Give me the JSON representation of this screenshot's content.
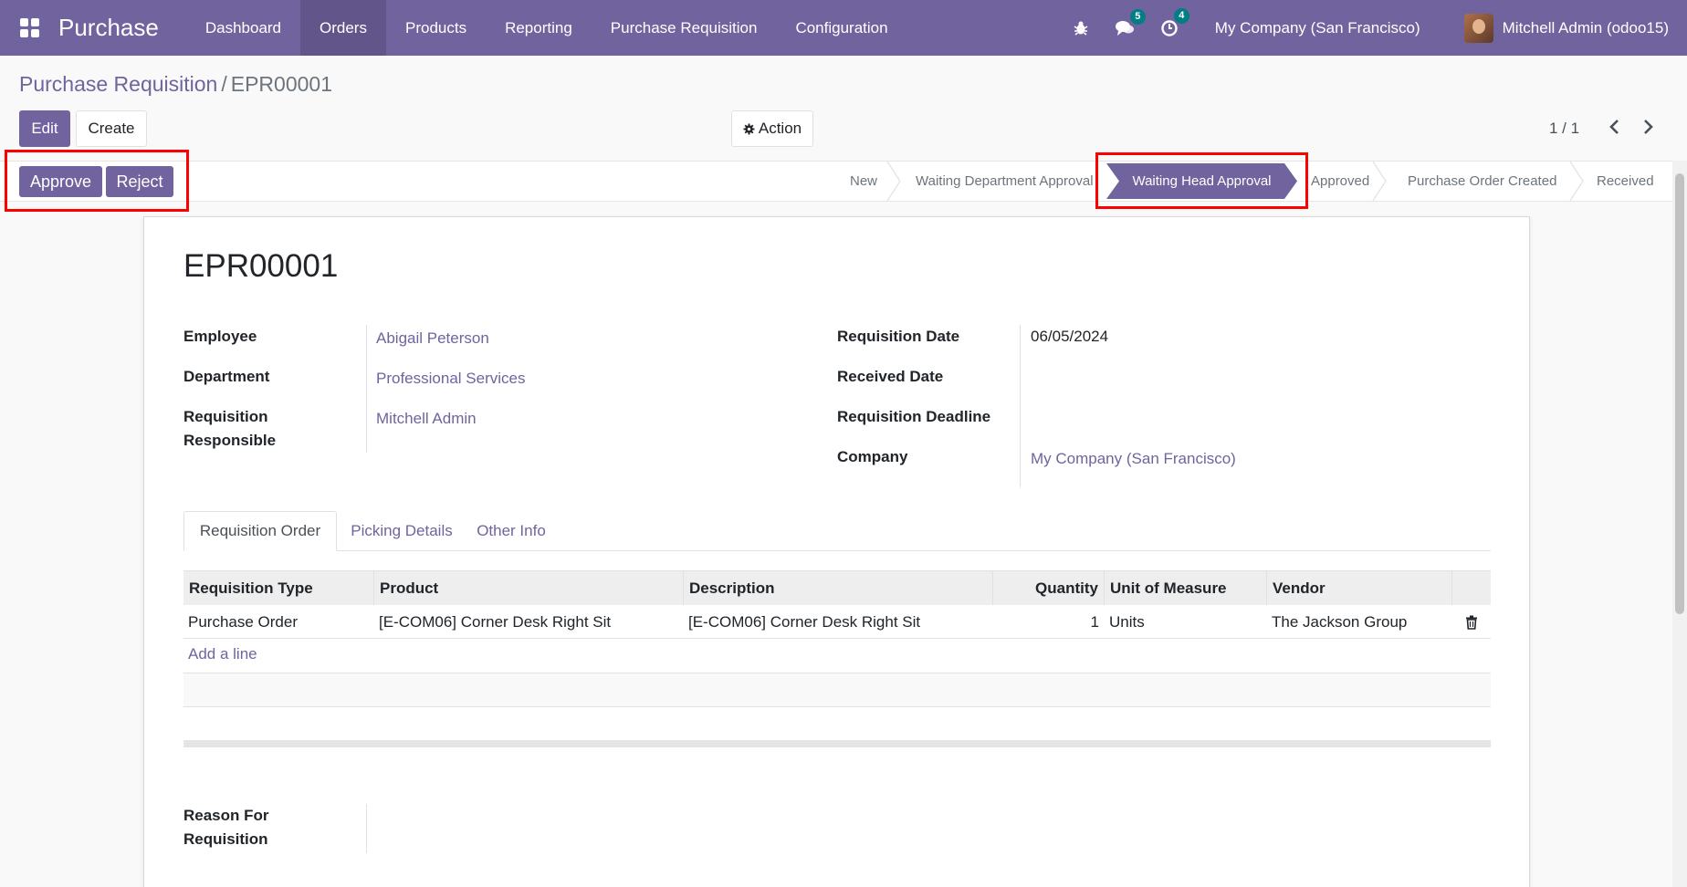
{
  "navbar": {
    "brand": "Purchase",
    "menu": [
      "Dashboard",
      "Orders",
      "Products",
      "Reporting",
      "Purchase Requisition",
      "Configuration"
    ],
    "active_menu": "Orders",
    "messages_count": "5",
    "activities_count": "4",
    "company": "My Company (San Francisco)",
    "user": "Mitchell Admin (odoo15)"
  },
  "breadcrumb": {
    "parent": "Purchase Requisition",
    "separator": "/",
    "current": "EPR00001"
  },
  "control": {
    "edit_label": "Edit",
    "create_label": "Create",
    "action_label": "Action",
    "pager": "1 / 1"
  },
  "status_buttons": {
    "approve": "Approve",
    "reject": "Reject"
  },
  "stages": [
    "New",
    "Waiting Department Approval",
    "Waiting Head Approval",
    "Approved",
    "Purchase Order Created",
    "Received"
  ],
  "active_stage": "Waiting Head Approval",
  "form": {
    "name": "EPR00001",
    "left": {
      "employee_label": "Employee",
      "employee": "Abigail Peterson",
      "department_label": "Department",
      "department": "Professional Services",
      "responsible_label_1": "Requisition",
      "responsible_label_2": "Responsible",
      "responsible": "Mitchell Admin"
    },
    "right": {
      "req_date_label": "Requisition Date",
      "req_date": "06/05/2024",
      "received_date_label": "Received Date",
      "deadline_label": "Requisition Deadline",
      "company_label": "Company",
      "company": "My Company (San Francisco)"
    },
    "tabs": [
      "Requisition Order",
      "Picking Details",
      "Other Info"
    ],
    "table": {
      "columns": [
        "Requisition Type",
        "Product",
        "Description",
        "Quantity",
        "Unit of Measure",
        "Vendor"
      ],
      "rows": [
        {
          "type": "Purchase Order",
          "product": "[E-COM06] Corner Desk Right Sit",
          "description": "[E-COM06] Corner Desk Right Sit",
          "quantity": "1",
          "uom": "Units",
          "vendor": "The Jackson Group"
        }
      ],
      "add_line": "Add a line"
    },
    "reason_label_1": "Reason For",
    "reason_label_2": "Requisition"
  },
  "colors": {
    "brand": "#71639e",
    "highlight": "#ff0000",
    "badge": "#017e84"
  }
}
